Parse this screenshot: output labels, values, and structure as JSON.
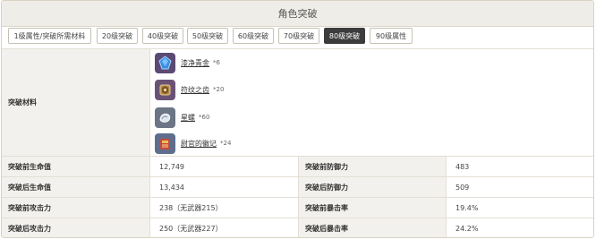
{
  "panel": {
    "title": "角色突破"
  },
  "tabs": [
    {
      "label": "1级属性/突破所需材料",
      "active": false
    },
    {
      "label": "20级突破",
      "active": false
    },
    {
      "label": "40级突破",
      "active": false
    },
    {
      "label": "50级突破",
      "active": false
    },
    {
      "label": "60级突破",
      "active": false
    },
    {
      "label": "70级突破",
      "active": false
    },
    {
      "label": "80级突破",
      "active": true
    },
    {
      "label": "90级属性",
      "active": false
    }
  ],
  "materials": {
    "label": "突破材料",
    "items": [
      {
        "name": "漆净青金",
        "count": "*6",
        "icon": "blue-gem-icon"
      },
      {
        "name": "符纹之齿",
        "count": "*20",
        "icon": "rune-tooth-icon"
      },
      {
        "name": "星螺",
        "count": "*60",
        "icon": "star-conch-icon"
      },
      {
        "name": "尉官的徽记",
        "count": "*24",
        "icon": "officer-insignia-icon"
      }
    ]
  },
  "stats": {
    "hp_before_label": "突破前生命值",
    "hp_before": "12,749",
    "def_before_label": "突破前防御力",
    "def_before": "483",
    "hp_after_label": "突破后生命值",
    "hp_after": "13,434",
    "def_after_label": "突破后防御力",
    "def_after": "509",
    "atk_before_label": "突破前攻击力",
    "atk_before": "238（无武器215）",
    "crit_before_label": "突破前暴击率",
    "crit_before": "19.4%",
    "atk_after_label": "突破后攻击力",
    "atk_after": "250（无武器227）",
    "crit_after_label": "突破后暴击率",
    "crit_after": "24.2%"
  },
  "colors": {
    "active_tab": "#3c3c3c",
    "label_bg": "#f3f1ed",
    "header_bg": "#efede8"
  }
}
